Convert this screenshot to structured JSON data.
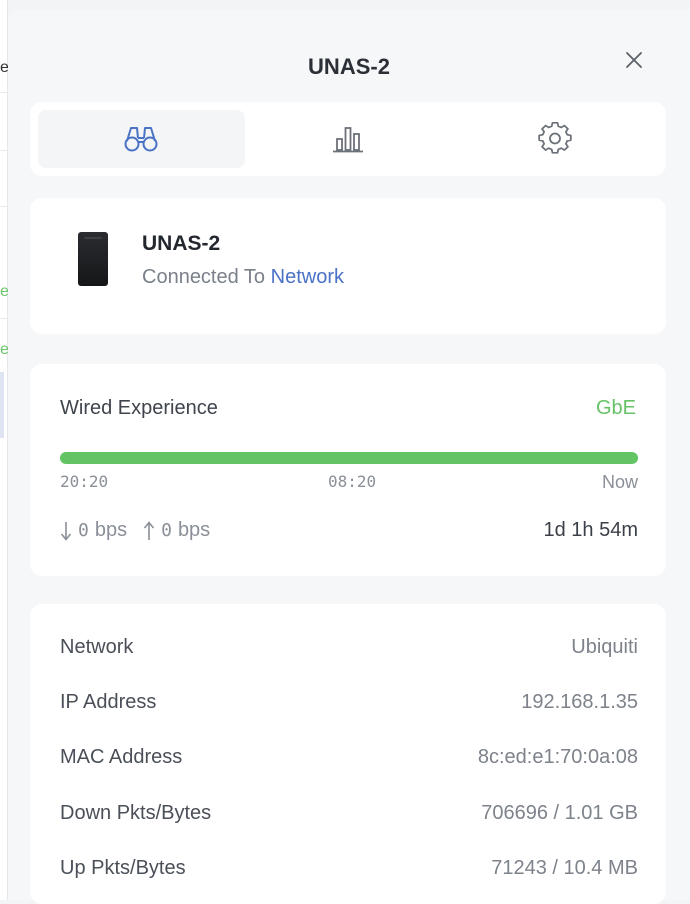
{
  "panel": {
    "title": "UNAS-2",
    "close_icon": "close-icon"
  },
  "tabs": [
    {
      "icon": "binoculars-icon",
      "active": true
    },
    {
      "icon": "bar-chart-icon",
      "active": false
    },
    {
      "icon": "gear-icon",
      "active": false
    }
  ],
  "device": {
    "name": "UNAS-2",
    "status_prefix": "Connected To",
    "status_link": "Network",
    "icon": "nas-device-icon"
  },
  "wired": {
    "title": "Wired Experience",
    "speed": "GbE",
    "quality": 1.0,
    "ticks": [
      "20:20",
      "08:20",
      "Now"
    ],
    "down_value": "0",
    "down_unit": "bps",
    "up_value": "0",
    "up_unit": "bps",
    "uptime": "1d 1h 54m"
  },
  "info": [
    {
      "label": "Network",
      "value": "Ubiquiti"
    },
    {
      "label": "IP Address",
      "value": "192.168.1.35"
    },
    {
      "label": "MAC Address",
      "value": "8c:ed:e1:70:0a:08"
    },
    {
      "label": "Down Pkts/Bytes",
      "value": "706696 / 1.01 GB"
    },
    {
      "label": "Up Pkts/Bytes",
      "value": "71243 / 10.4 MB"
    }
  ],
  "colors": {
    "accent_green": "#63c463",
    "link_blue": "#4a72c5",
    "panel_bg": "#f6f7f8",
    "card_bg": "#ffffff"
  }
}
